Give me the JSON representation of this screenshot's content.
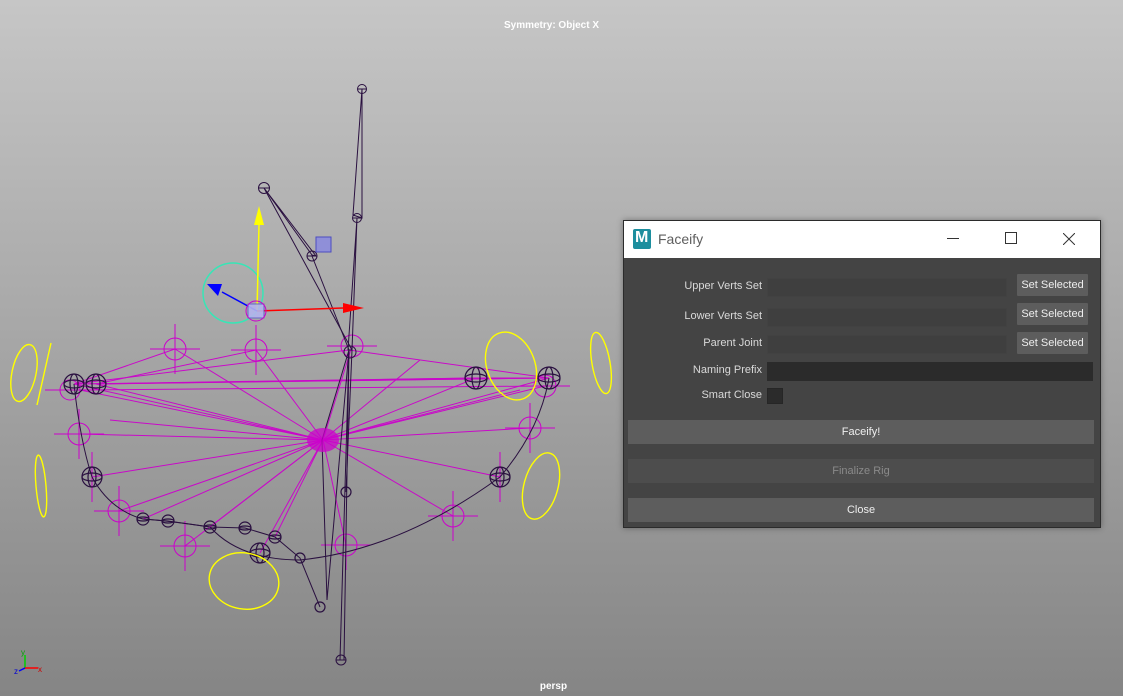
{
  "viewport": {
    "symmetry_label": "Symmetry: Object X",
    "camera_label": "persp",
    "axis_labels": {
      "x": "x",
      "y": "y",
      "z": "z"
    }
  },
  "dialog": {
    "title": "Faceify",
    "logo_letter": "M",
    "rows": {
      "upper_verts": {
        "label": "Upper Verts Set",
        "value": "",
        "button": "Set Selected"
      },
      "lower_verts": {
        "label": "Lower Verts Set",
        "value": "",
        "button": "Set Selected"
      },
      "parent_joint": {
        "label": "Parent Joint",
        "value": "",
        "button": "Set Selected"
      },
      "naming_prefix": {
        "label": "Naming Prefix",
        "value": ""
      },
      "smart_close": {
        "label": "Smart Close",
        "checked": false
      }
    },
    "buttons": {
      "faceify": "Faceify!",
      "finalize": "Finalize Rig",
      "close": "Close"
    }
  },
  "colors": {
    "viewport_top": "#c6c6c6",
    "viewport_bottom": "#858585",
    "joint_magenta": "#cc00cc",
    "joint_dark": "#2a1040",
    "control_yellow": "#ffff00",
    "gizmo_red": "#ff0000",
    "gizmo_yellow": "#ffff00",
    "gizmo_blue": "#0000ff",
    "gizmo_ring": "#37e6b6",
    "dialog_bg": "#444444",
    "button_bg": "#5d5d5d"
  },
  "icons": [
    "maya-logo-icon",
    "minimize-icon",
    "maximize-icon",
    "close-icon",
    "axis-triad-icon"
  ]
}
